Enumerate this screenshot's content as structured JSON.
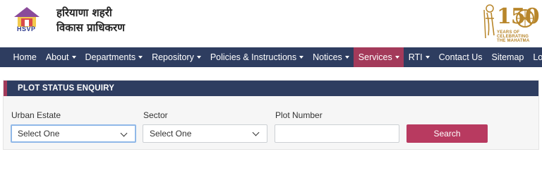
{
  "header": {
    "logo_text": "HSVP",
    "brand_line1": "हरियाणा शहरी",
    "brand_line2": "विकास प्राधिकरण",
    "gandhi_number": "150",
    "gandhi_line1": "YEARS OF",
    "gandhi_line2": "CELEBRATING",
    "gandhi_line3": "THE MAHATMA"
  },
  "nav": {
    "items": [
      {
        "label": "Home"
      },
      {
        "label": "About"
      },
      {
        "label": "Departments"
      },
      {
        "label": "Repository"
      },
      {
        "label": "Policies & Instructions"
      },
      {
        "label": "Notices"
      },
      {
        "label": "Services"
      },
      {
        "label": "RTI"
      },
      {
        "label": "Contact Us"
      },
      {
        "label": "Sitemap"
      },
      {
        "label": "Login"
      }
    ],
    "active_index": 6
  },
  "panel": {
    "title": "PLOT STATUS ENQUIRY",
    "urban_estate_label": "Urban Estate",
    "urban_estate_value": "Select One",
    "sector_label": "Sector",
    "sector_value": "Select One",
    "plot_number_label": "Plot Number",
    "plot_number_value": "",
    "plot_number_placeholder": "",
    "search_label": "Search"
  },
  "colors": {
    "nav_bg": "#2e3d60",
    "accent": "#a33a5a",
    "button": "#b83a60",
    "brand_gold": "#b8862b"
  }
}
